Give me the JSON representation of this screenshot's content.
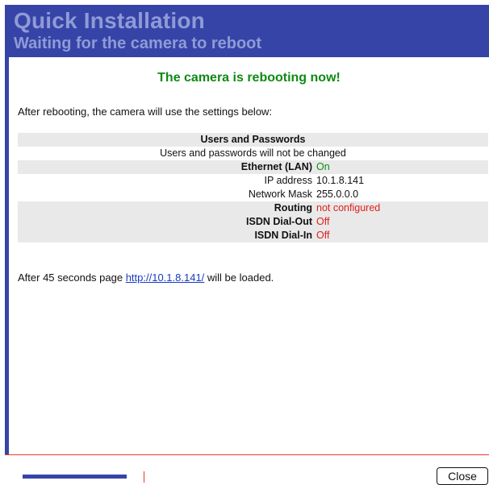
{
  "header": {
    "title": "Quick Installation",
    "subtitle": "Waiting for the camera to reboot"
  },
  "content": {
    "headline": "The camera is rebooting now!",
    "intro": "After rebooting, the camera will use the settings below:",
    "settings": {
      "users_heading": "Users and Passwords",
      "users_note": "Users and passwords will not be changed",
      "ethernet_label": "Ethernet (LAN)",
      "ethernet_value": "On",
      "ip_label": "IP address",
      "ip_value": "10.1.8.141",
      "mask_label": "Network Mask",
      "mask_value": "255.0.0.0",
      "routing_label": "Routing",
      "routing_value": "not configured",
      "dialout_label": "ISDN Dial-Out",
      "dialout_value": "Off",
      "dialin_label": "ISDN Dial-In",
      "dialin_value": "Off"
    },
    "reload_prefix": "After 45 seconds page ",
    "reload_link": "http://10.1.8.141/",
    "reload_suffix": " will be loaded."
  },
  "footer": {
    "progress_percent": 86,
    "close_label": "Close"
  },
  "colors": {
    "header_bg": "#3744a7",
    "header_text": "#8e9bd6",
    "ok_green": "#0f8a14",
    "alert_red": "#e0201c",
    "link_blue": "#1a3bbf"
  }
}
